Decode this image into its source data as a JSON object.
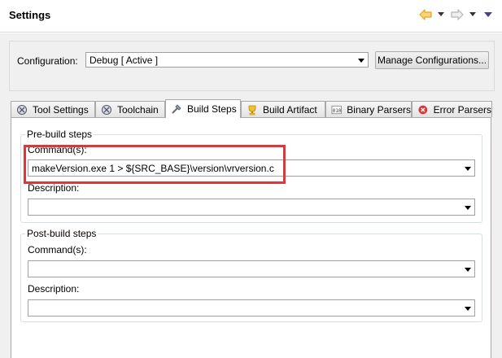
{
  "header": {
    "title": "Settings"
  },
  "configuration": {
    "label": "Configuration:",
    "selected": "Debug  [ Active ]",
    "manage_button": "Manage Configurations..."
  },
  "tabs": [
    {
      "label": "Tool Settings",
      "icon": "tool-settings-icon"
    },
    {
      "label": "Toolchain",
      "icon": "toolchain-icon"
    },
    {
      "label": "Build Steps",
      "icon": "build-steps-icon",
      "active": true
    },
    {
      "label": "Build Artifact",
      "icon": "build-artifact-icon"
    },
    {
      "label": "Binary Parsers",
      "icon": "binary-parsers-icon"
    },
    {
      "label": "Error Parsers",
      "icon": "error-parsers-icon"
    }
  ],
  "pre_build": {
    "title": "Pre-build steps",
    "command_label": "Command(s):",
    "command_value": "makeVersion.exe 1 > ${SRC_BASE}\\version\\vrversion.c",
    "description_label": "Description:",
    "description_value": ""
  },
  "post_build": {
    "title": "Post-build steps",
    "command_label": "Command(s):",
    "command_value": "",
    "description_label": "Description:",
    "description_value": ""
  },
  "colors": {
    "highlight": "#d9393b",
    "nav_back": "#e8a317",
    "header_bg": "#ffffff",
    "body_bg": "#f0f0f0"
  }
}
